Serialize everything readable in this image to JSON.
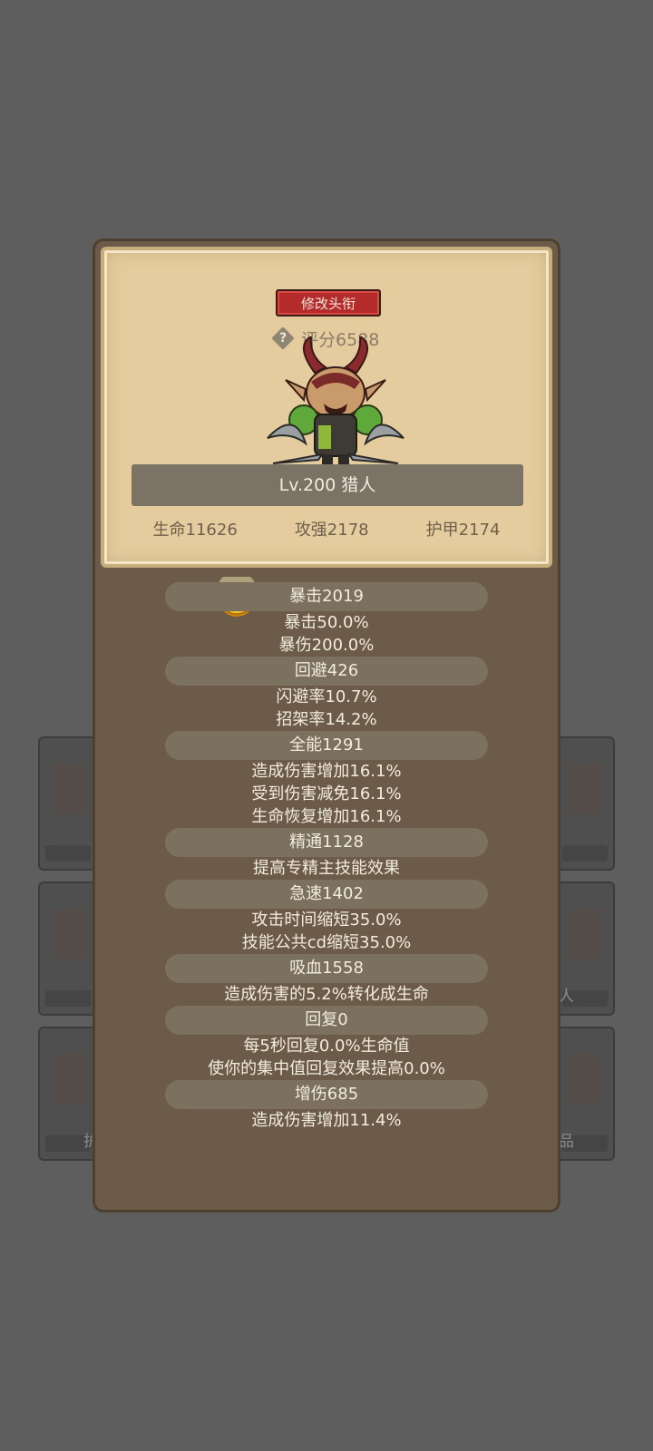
{
  "background": {
    "left_slots": [
      {
        "label": ""
      },
      {
        "label": ""
      },
      {
        "label": "护"
      }
    ],
    "right_slots": [
      {
        "label": ""
      },
      {
        "label": "人"
      },
      {
        "label": "品"
      }
    ]
  },
  "panel": {
    "title_button": "修改头衔",
    "help_icon_glyph": "?",
    "score": "评分6588",
    "level_class": "Lv.200 猎人",
    "stats": {
      "hp": "生命11626",
      "attack": "攻强2178",
      "armor": "护甲2174"
    }
  },
  "attributes": [
    {
      "header": "暴击2019",
      "lines": [
        "暴击50.0%",
        "暴伤200.0%"
      ]
    },
    {
      "header": "回避426",
      "lines": [
        "闪避率10.7%",
        "招架率14.2%"
      ]
    },
    {
      "header": "全能1291",
      "lines": [
        "造成伤害增加16.1%",
        "受到伤害减免16.1%",
        "生命恢复增加16.1%"
      ]
    },
    {
      "header": "精通1128",
      "lines": [
        "提高专精主技能效果"
      ]
    },
    {
      "header": "急速1402",
      "lines": [
        "攻击时间缩短35.0%",
        "技能公共cd缩短35.0%"
      ]
    },
    {
      "header": "吸血1558",
      "lines": [
        "造成伤害的5.2%转化成生命"
      ]
    },
    {
      "header": "回复0",
      "lines": [
        "每5秒回复0.0%生命值",
        "使你的集中值回复效果提高0.0%"
      ]
    },
    {
      "header": "增伤685",
      "lines": [
        "造成伤害增加11.4%"
      ]
    }
  ],
  "colors": {
    "panel_brown": "#6c5b48",
    "card_parchment": "#e4cc9e",
    "title_red": "#b52a2a",
    "banner_gray": "#7b7366",
    "coin_gold": "#e9b21c"
  },
  "icons": [
    "help-icon",
    "gold-coin-icon",
    "hero-portrait"
  ]
}
